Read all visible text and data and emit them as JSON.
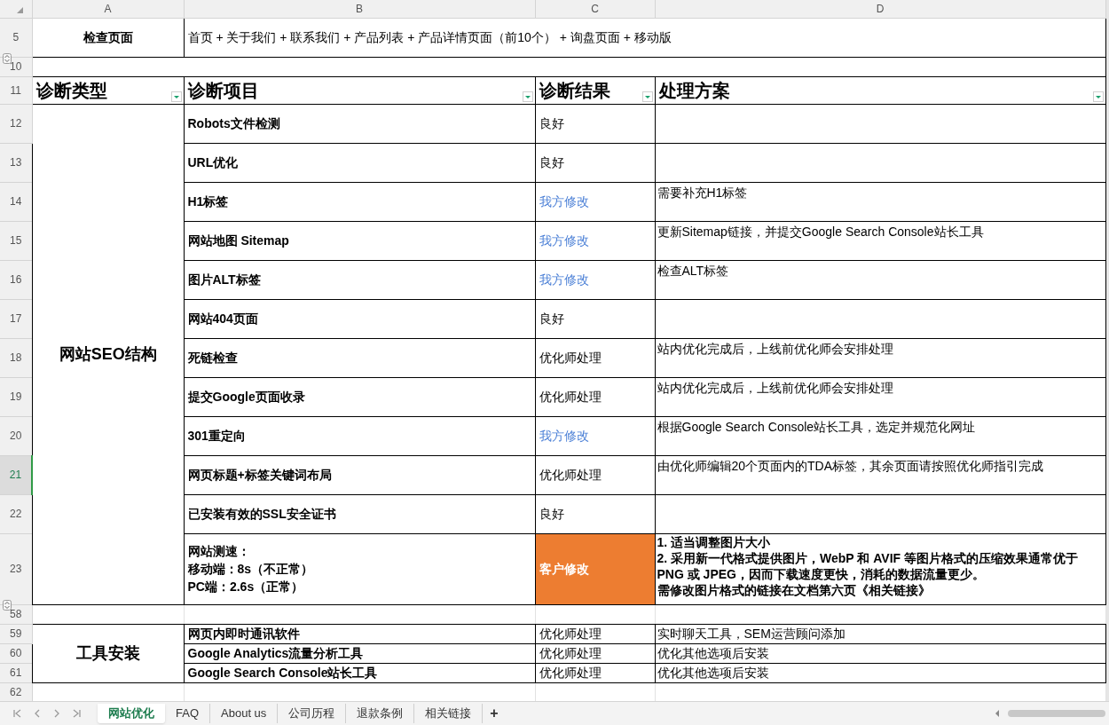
{
  "columns": [
    "A",
    "B",
    "C",
    "D"
  ],
  "check_row": {
    "number": "5",
    "label": "检查页面",
    "value": "首页 + 关于我们 + 联系我们 + 产品列表 + 产品详情页面（前10个） + 询盘页面 + 移动版"
  },
  "spacer_row": {
    "number": "10"
  },
  "header_row": {
    "number": "11",
    "cells": [
      "诊断类型",
      "诊断项目",
      "诊断结果",
      "处理方案"
    ]
  },
  "groups": [
    {
      "type": "网站SEO结构",
      "rows": [
        {
          "number": "12",
          "kind": "plain",
          "item": [
            "Robots文件检测"
          ],
          "result": "良好",
          "solution": [],
          "selected": false
        },
        {
          "number": "13",
          "kind": "plain",
          "item": [
            "URL优化"
          ],
          "result": "良好",
          "solution": [],
          "selected": false
        },
        {
          "number": "14",
          "kind": "ours",
          "item": [
            "H1标签"
          ],
          "result": "我方修改",
          "solution": [
            "需要补充H1标签"
          ],
          "selected": false
        },
        {
          "number": "15",
          "kind": "ours",
          "item": [
            "网站地图 Sitemap"
          ],
          "result": "我方修改",
          "solution": [
            "更新Sitemap链接，并提交Google Search Console站长工具"
          ],
          "selected": false
        },
        {
          "number": "16",
          "kind": "ours",
          "item": [
            "图片ALT标签"
          ],
          "result": "我方修改",
          "solution": [
            "检查ALT标签"
          ],
          "selected": false
        },
        {
          "number": "17",
          "kind": "plain",
          "item": [
            "网站404页面"
          ],
          "result": "良好",
          "solution": [],
          "selected": false
        },
        {
          "number": "18",
          "kind": "plain",
          "item": [
            "死链检查"
          ],
          "result": "优化师处理",
          "solution": [
            "站内优化完成后，上线前优化师会安排处理"
          ],
          "selected": false
        },
        {
          "number": "19",
          "kind": "plain",
          "item": [
            "提交Google页面收录"
          ],
          "result": "优化师处理",
          "solution": [
            "站内优化完成后，上线前优化师会安排处理"
          ],
          "selected": false
        },
        {
          "number": "20",
          "kind": "ours",
          "item": [
            "301重定向"
          ],
          "result": "我方修改",
          "solution": [
            "根据Google Search Console站长工具，选定并规范化网址"
          ],
          "selected": false
        },
        {
          "number": "21",
          "kind": "plain",
          "item": [
            "网页标题+标签关键词布局"
          ],
          "result": "优化师处理",
          "solution": [
            "由优化师编辑20个页面内的TDA标签，其余页面请按照优化师指引完成"
          ],
          "selected": true
        },
        {
          "number": "22",
          "kind": "plain",
          "item": [
            "已安装有效的SSL安全证书"
          ],
          "result": "良好",
          "solution": [],
          "selected": false
        },
        {
          "number": "23",
          "kind": "client",
          "item": [
            "网站测速：",
            "移动端：8s（不正常）",
            "PC端：2.6s（正常）"
          ],
          "result": "客户修改",
          "solution": [
            "1. 适当调整图片大小",
            "2. 采用新一代格式提供图片，WebP 和 AVIF 等图片格式的压缩效果通常优于 PNG 或 JPEG，因而下载速度更快，消耗的数据流量更少。",
            "需修改图片格式的链接在文档第六页《相关链接》"
          ],
          "selected": false
        }
      ]
    },
    {
      "spacer_number": "58",
      "type": "工具安装",
      "rows": [
        {
          "number": "59",
          "kind": "plain",
          "item": [
            "网页内即时通讯软件"
          ],
          "result": "优化师处理",
          "solution": [
            "实时聊天工具，SEM运营顾问添加"
          ],
          "selected": false
        },
        {
          "number": "60",
          "kind": "plain",
          "item": [
            "Google Analytics流量分析工具"
          ],
          "result": "优化师处理",
          "solution": [
            "优化其他选项后安装"
          ],
          "selected": false
        },
        {
          "number": "61",
          "kind": "plain",
          "item": [
            "Google Search Console站长工具"
          ],
          "result": "优化师处理",
          "solution": [
            "优化其他选项后安装"
          ],
          "selected": false
        }
      ]
    }
  ],
  "last_row": {
    "number": "62"
  },
  "sheet_tabs": [
    {
      "label": "网站优化",
      "selected": true
    },
    {
      "label": "FAQ",
      "selected": false
    },
    {
      "label": "About us",
      "selected": false
    },
    {
      "label": "公司历程",
      "selected": false
    },
    {
      "label": "退款条例",
      "selected": false
    },
    {
      "label": "相关链接",
      "selected": false
    }
  ],
  "add_tab": "+"
}
